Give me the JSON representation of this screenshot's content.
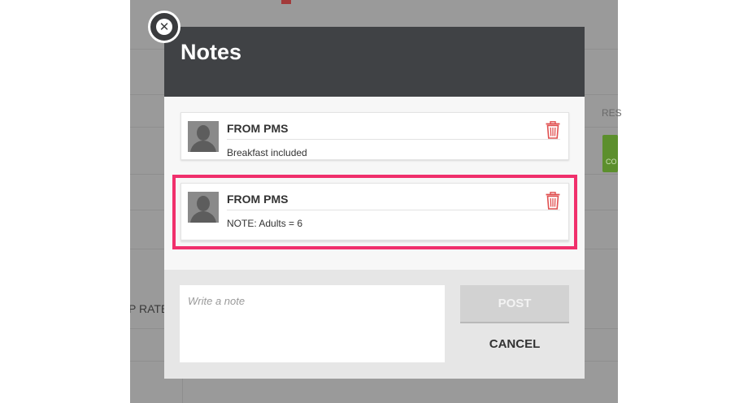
{
  "background": {
    "left_label": "P RATE",
    "right_label": "RES",
    "green_button_label": "CO"
  },
  "modal": {
    "title": "Notes",
    "close_icon": "close-icon",
    "notes": [
      {
        "author": "FROM PMS",
        "text": "Breakfast included",
        "highlighted": false
      },
      {
        "author": "FROM PMS",
        "text": "NOTE: Adults = 6",
        "highlighted": true
      }
    ],
    "compose": {
      "placeholder": "Write a note",
      "value": "",
      "post_label": "POST",
      "cancel_label": "CANCEL"
    }
  },
  "colors": {
    "header": "#404245",
    "highlight": "#f0306c",
    "trash": "#e05050",
    "post_disabled": "#d2d2d2"
  }
}
